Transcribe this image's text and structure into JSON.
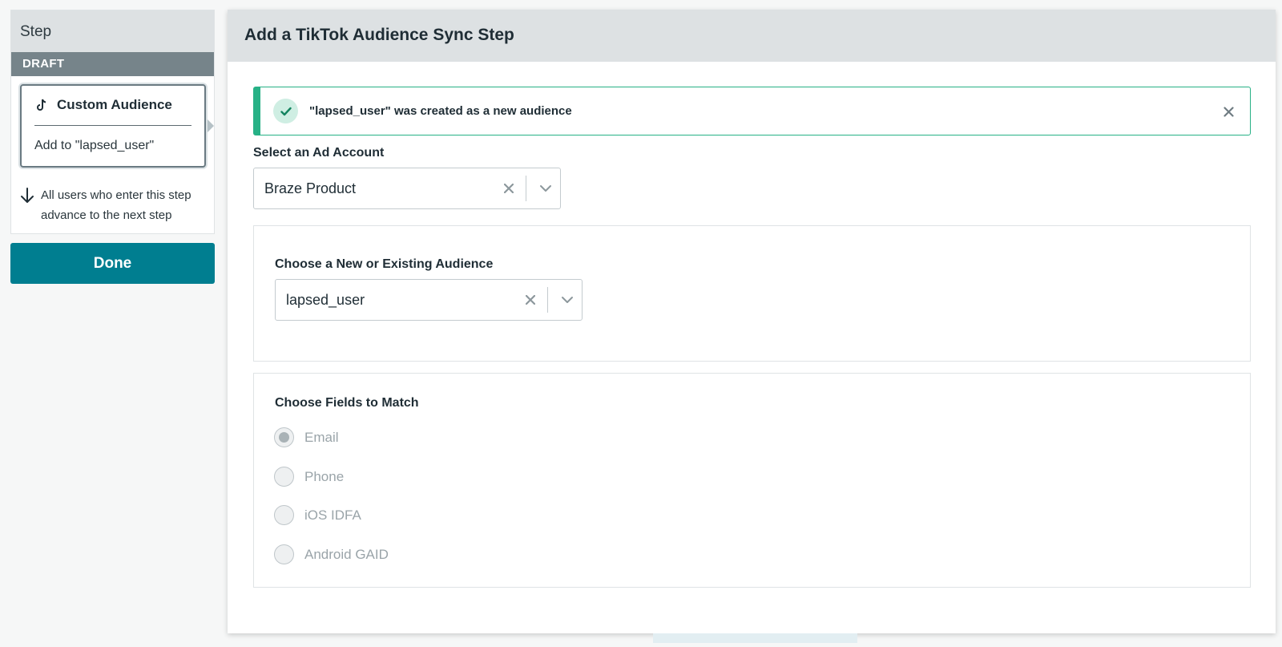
{
  "sidebar": {
    "step_label": "Step",
    "status_badge": "DRAFT",
    "card": {
      "icon": "tiktok-icon",
      "title": "Custom Audience",
      "subtitle": "Add to \"lapsed_user\""
    },
    "advance_text": "All users who enter this step advance to the next step",
    "done_label": "Done"
  },
  "modal": {
    "title": "Add a TikTok Audience Sync Step",
    "alert": {
      "message": "\"lapsed_user\" was created as a new audience",
      "color": "#27b186"
    },
    "ad_account": {
      "label": "Select an Ad Account",
      "value": "Braze Product"
    },
    "audience": {
      "label": "Choose a New or Existing Audience",
      "value": "lapsed_user"
    },
    "match_fields": {
      "label": "Choose Fields to Match",
      "options": [
        {
          "label": "Email",
          "checked": true
        },
        {
          "label": "Phone",
          "checked": false
        },
        {
          "label": "iOS IDFA",
          "checked": false
        },
        {
          "label": "Android GAID",
          "checked": false
        }
      ]
    }
  },
  "colors": {
    "primary": "#007e90",
    "success": "#27b186",
    "header_bg": "#dde1e3",
    "draft_bg": "#76848a"
  }
}
